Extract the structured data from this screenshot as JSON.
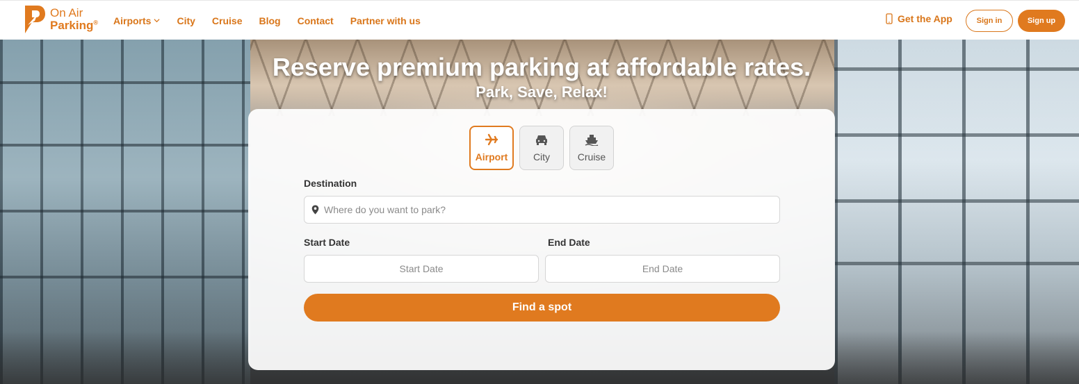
{
  "brand": {
    "line1": "On Air",
    "line2": "Parking",
    "reg": "®",
    "color": "#e07a1f"
  },
  "nav": {
    "links": [
      {
        "label": "Airports",
        "has_dropdown": true
      },
      {
        "label": "City"
      },
      {
        "label": "Cruise"
      },
      {
        "label": "Blog"
      },
      {
        "label": "Contact"
      },
      {
        "label": "Partner with us"
      }
    ],
    "get_app": "Get the App",
    "sign_in": "Sign in",
    "sign_up": "Sign up"
  },
  "hero": {
    "title": "Reserve premium parking at affordable rates.",
    "subtitle": "Park, Save, Relax!"
  },
  "search": {
    "modes": [
      {
        "label": "Airport",
        "icon": "airplane-icon",
        "active": true
      },
      {
        "label": "City",
        "icon": "car-icon",
        "active": false
      },
      {
        "label": "Cruise",
        "icon": "ship-icon",
        "active": false
      }
    ],
    "destination_label": "Destination",
    "destination_placeholder": "Where do you want to park?",
    "start_label": "Start Date",
    "start_placeholder": "Start Date",
    "end_label": "End Date",
    "end_placeholder": "End Date",
    "submit": "Find a spot"
  }
}
